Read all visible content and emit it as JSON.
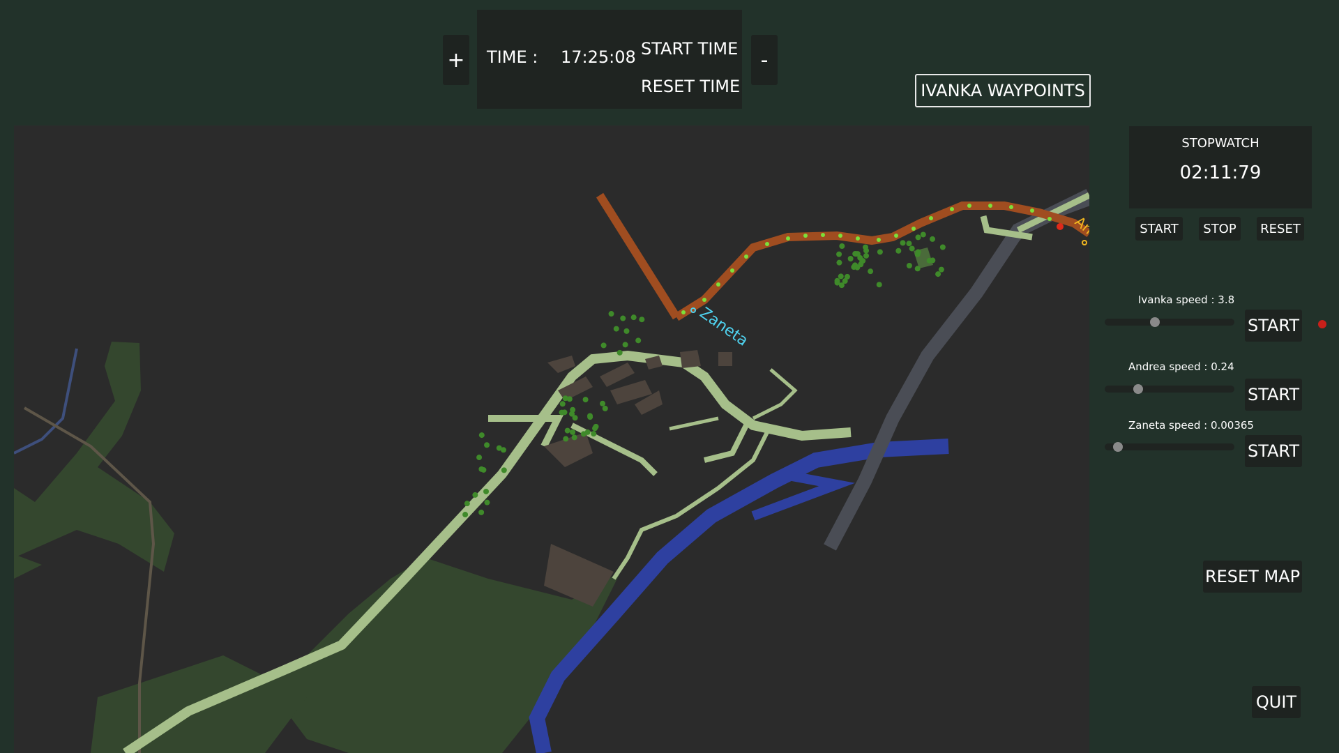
{
  "time_panel": {
    "plus": "+",
    "minus": "-",
    "time_label": "TIME :",
    "time_value": "17:25:08",
    "start_time": "START TIME",
    "reset_time": "RESET TIME"
  },
  "waypoints_button": "IVANKA WAYPOINTS",
  "stopwatch": {
    "title": "STOPWATCH",
    "value": "02:11:79",
    "start": "START",
    "stop": "STOP",
    "reset": "RESET"
  },
  "agents": [
    {
      "label": "Ivanka speed :  3.8",
      "button": "START",
      "slider_fraction": 0.38
    },
    {
      "label": "Andrea speed :  0.24",
      "button": "START",
      "slider_fraction": 0.24
    },
    {
      "label": "Zaneta speed :  0.00365",
      "button": "START",
      "slider_fraction": 0.07
    }
  ],
  "map_labels": {
    "zaneta": "Zaneta",
    "andrea": "Andrea"
  },
  "reset_map": "RESET MAP",
  "quit": "QUIT",
  "colors": {
    "background": "#22322a",
    "map_background": "#2b2b2b",
    "road": "#a6bf8a",
    "route": "#a04d20",
    "river": "#2e40a0",
    "highway": "#4a4d55",
    "forest": "#34472e",
    "waypoint": "#7ce03a",
    "zaneta_label": "#4fd3f0",
    "andrea_label": "#f3b820",
    "agent_marker": "#e02a1a"
  }
}
